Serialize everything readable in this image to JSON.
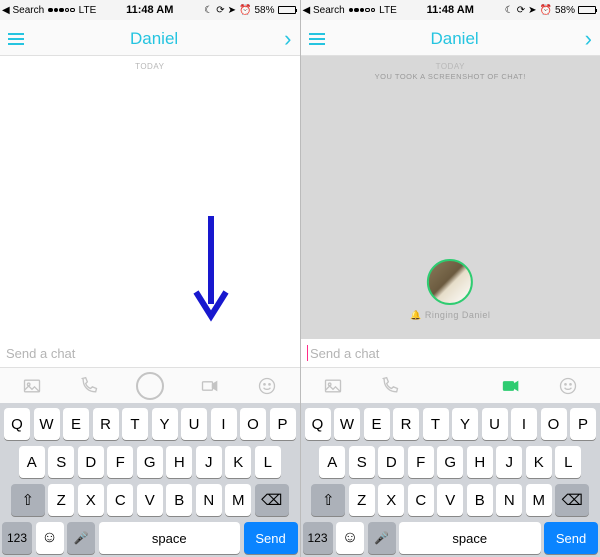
{
  "left": {
    "status": {
      "back": "Search",
      "carrier": "LTE",
      "time": "11:48 AM",
      "battery_pct": "58%"
    },
    "nav": {
      "title": "Daniel"
    },
    "chat": {
      "date_label": "TODAY"
    },
    "input": {
      "placeholder": "Send a chat"
    },
    "keyboard": {
      "row1": [
        "Q",
        "W",
        "E",
        "R",
        "T",
        "Y",
        "U",
        "I",
        "O",
        "P"
      ],
      "row2": [
        "A",
        "S",
        "D",
        "F",
        "G",
        "H",
        "J",
        "K",
        "L"
      ],
      "row3": [
        "Z",
        "X",
        "C",
        "V",
        "B",
        "N",
        "M"
      ],
      "numkey": "123",
      "space": "space",
      "send": "Send"
    }
  },
  "right": {
    "status": {
      "back": "Search",
      "carrier": "LTE",
      "time": "11:48 AM",
      "battery_pct": "58%"
    },
    "nav": {
      "title": "Daniel"
    },
    "chat": {
      "date_label": "TODAY",
      "screenshot_msg": "YOU TOOK A SCREENSHOT OF CHAT!",
      "ringing": "🔔 Ringing Daniel"
    },
    "input": {
      "placeholder": "Send a chat"
    },
    "keyboard": {
      "row1": [
        "Q",
        "W",
        "E",
        "R",
        "T",
        "Y",
        "U",
        "I",
        "O",
        "P"
      ],
      "row2": [
        "A",
        "S",
        "D",
        "F",
        "G",
        "H",
        "J",
        "K",
        "L"
      ],
      "row3": [
        "Z",
        "X",
        "C",
        "V",
        "B",
        "N",
        "M"
      ],
      "numkey": "123",
      "space": "space",
      "send": "Send"
    }
  }
}
